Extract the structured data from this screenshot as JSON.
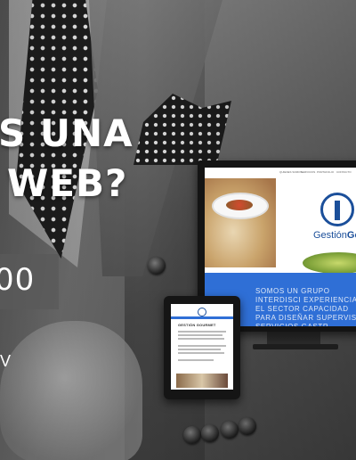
{
  "headline": {
    "line1": "S UNA",
    "line2": "WEB?"
  },
  "price": {
    "value": "00"
  },
  "side_fragment": "V",
  "mockup": {
    "desktop_nav": [
      "QUIENES SOMOS",
      "SERVICIOS",
      "PORTAFOLIO",
      "CONTACTO"
    ],
    "logo_prefix": "Gestión",
    "logo_suffix": "Gou",
    "band_text": "SOMOS UN GRUPO INTERDISCI EXPERIENCIA EN EL SECTOR CAPACIDAD PARA DISEÑAR SUPERVISAR SERVICIOS GASTR",
    "tablet_title": "GESTIÓN GOURMET"
  }
}
